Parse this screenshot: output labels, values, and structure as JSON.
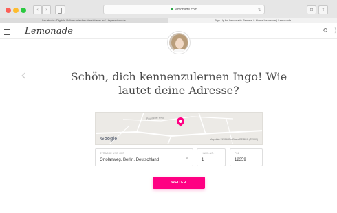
{
  "browser": {
    "url": "lemonade.com",
    "tabs": [
      {
        "label": "Insurtechs: Digitale Policen mischen Versicherer auf | tagesschau.de"
      },
      {
        "label": "Sign Up for Lemonade Renters & Home Insurance | Lemonade"
      }
    ],
    "back_icon": "‹",
    "forward_icon": "›",
    "share_icon": "⇪",
    "reader_icon": "⊡",
    "reload_icon": "↻"
  },
  "header": {
    "logo": "Lemonade",
    "menu_icon": "hamburger-icon",
    "undo_icon": "⟲",
    "edge_icon": "⟩"
  },
  "nav": {
    "prev_arrow": "‹"
  },
  "main": {
    "title": "Schön, dich kennenzulernen Ingo! Wie lautet deine Adresse?"
  },
  "map": {
    "street_label": "Paulinener Weg",
    "provider": "Google",
    "attribution": "Map data ©2016 GeoBasis-DE/BKG (©2009)"
  },
  "address": {
    "street_label": "Straße und Ort",
    "street_value": "Ortolanweg, Berlin, Deutschland",
    "clear_icon": "✕",
    "house_label": "Haus-Nr.",
    "house_value": "1",
    "plz_label": "PLZ",
    "plz_value": "12359"
  },
  "cta": {
    "label": "WEITER"
  },
  "colors": {
    "accent": "#ff0083",
    "title_text": "#4a4a4a"
  }
}
